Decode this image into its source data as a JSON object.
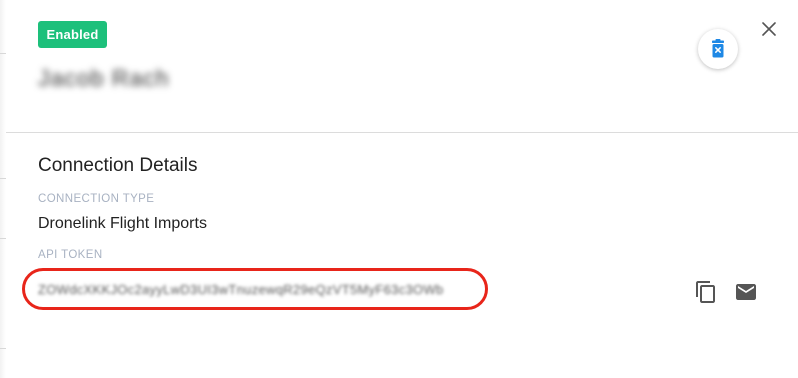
{
  "status_badge": "Enabled",
  "user_name": "Jacob Rach",
  "section_title": "Connection Details",
  "connection_type": {
    "label": "CONNECTION TYPE",
    "value": "Dronelink Flight Imports"
  },
  "api_token": {
    "label": "API TOKEN",
    "value": "ZOWdcXKKJOc2ayyLwD3UI3wTnuzewqR29eQzVT5MyF63c3OWb"
  },
  "icons": {
    "close": "close-icon",
    "delete": "trash-icon",
    "copy": "copy-icon",
    "email": "mail-icon"
  },
  "colors": {
    "badge": "#1dc07b",
    "delete_icon": "#1e88e5",
    "highlight": "#e8251a",
    "label": "#a8b2c2"
  }
}
